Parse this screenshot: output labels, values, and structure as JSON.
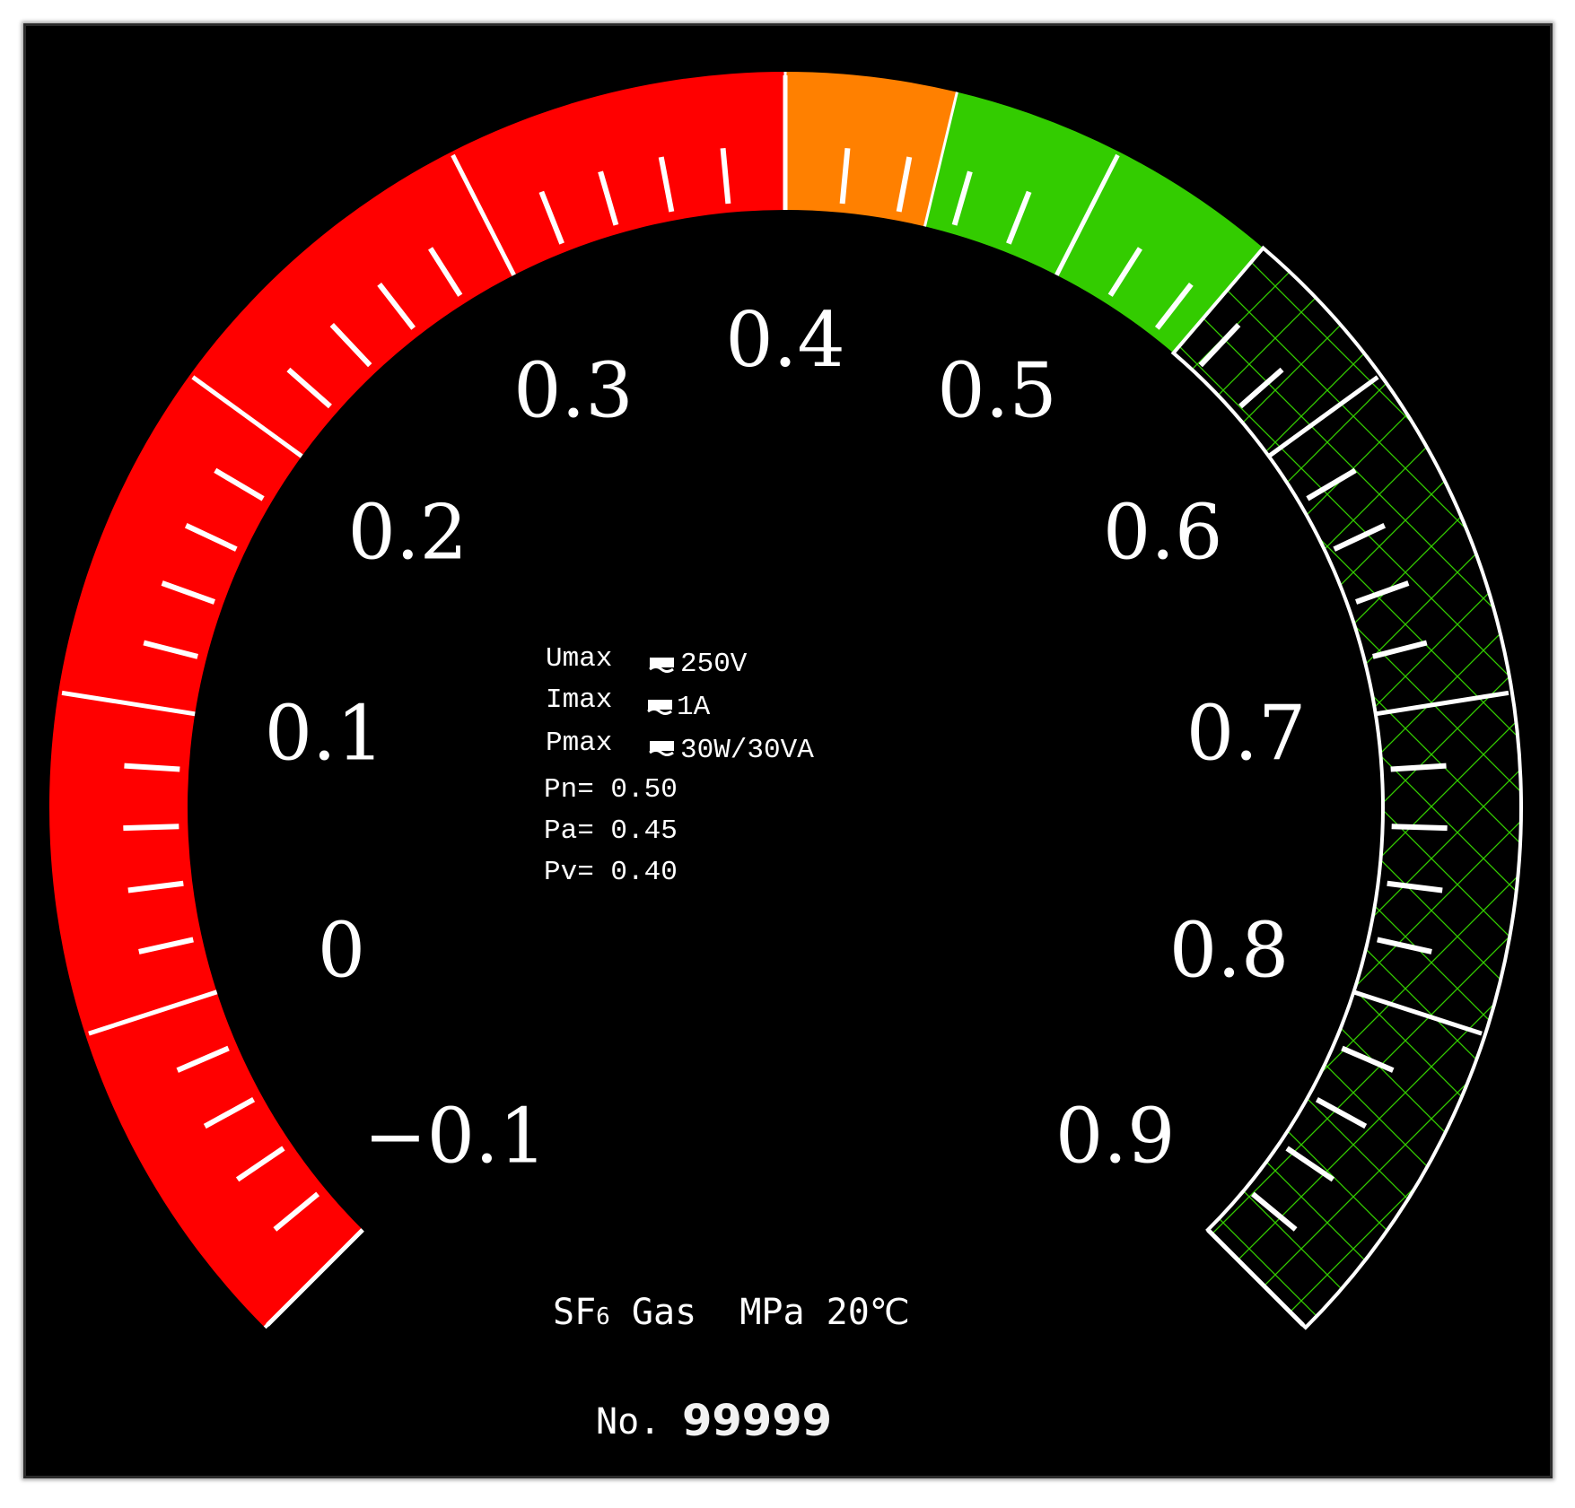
{
  "gauge": {
    "min": -0.1,
    "max": 0.9,
    "scale_labels": [
      "−0.1",
      "0",
      "0.1",
      "0.2",
      "0.3",
      "0.4",
      "0.5",
      "0.6",
      "0.7",
      "0.8",
      "0.9"
    ],
    "zones": [
      {
        "name": "red",
        "from": -0.1,
        "to": 0.4,
        "color": "#ff0000"
      },
      {
        "name": "orange",
        "from": 0.4,
        "to": 0.45,
        "color": "#ff8000"
      },
      {
        "name": "green",
        "from": 0.45,
        "to": 0.55,
        "color": "#33cc00"
      },
      {
        "name": "hatched",
        "from": 0.55,
        "to": 0.9,
        "color": "#000000",
        "hatch_color": "#33cc00"
      }
    ]
  },
  "specs": {
    "umax_label": "Umax",
    "umax_value": "250V",
    "imax_label": "Imax",
    "imax_value": "1A",
    "pmax_label": "Pmax",
    "pmax_value": "30W/30VA",
    "pn": "Pn= 0.50",
    "pa": "Pa= 0.45",
    "pv": "Pv= 0.40"
  },
  "footer": {
    "gas_sf": "SF",
    "gas_sub": "6",
    "gas_rest": " Gas  MPa 20℃",
    "serial_prefix": "No.",
    "serial_number": "99999"
  },
  "colors": {
    "background": "#000000",
    "ticks": "#ffffff",
    "outline": "#ffffff"
  }
}
